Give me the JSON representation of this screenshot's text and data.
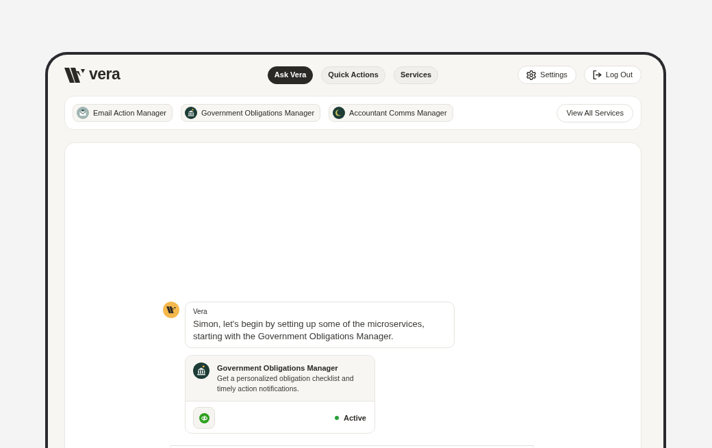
{
  "header": {
    "logo": {
      "text": "vera"
    },
    "nav": [
      {
        "label": "Ask Vera",
        "selected": true
      },
      {
        "label": "Quick Actions",
        "selected": false
      },
      {
        "label": "Services",
        "selected": false
      }
    ],
    "actions": [
      {
        "label": "Settings",
        "kind": "settings"
      },
      {
        "label": "Log Out",
        "kind": "logout"
      }
    ]
  },
  "services_bar": {
    "services": [
      {
        "label": "Email Action Manager",
        "kind": "email"
      },
      {
        "label": "Government Obligations Manager",
        "kind": "government"
      },
      {
        "label": "Accountant Comms Manager",
        "kind": "accountant"
      }
    ],
    "view_all": "View All Services"
  },
  "chat": {
    "messages": [
      {
        "sender": "Vera",
        "text": "Simon, let's begin by setting up some of the microservices, starting with the Government Obligations Manager.",
        "card": {
          "kind": "government",
          "title": "Government Obligations Manager",
          "description": "Get a personalized obligation checklist and timely action notifications.",
          "status": "Active"
        }
      }
    ]
  }
}
